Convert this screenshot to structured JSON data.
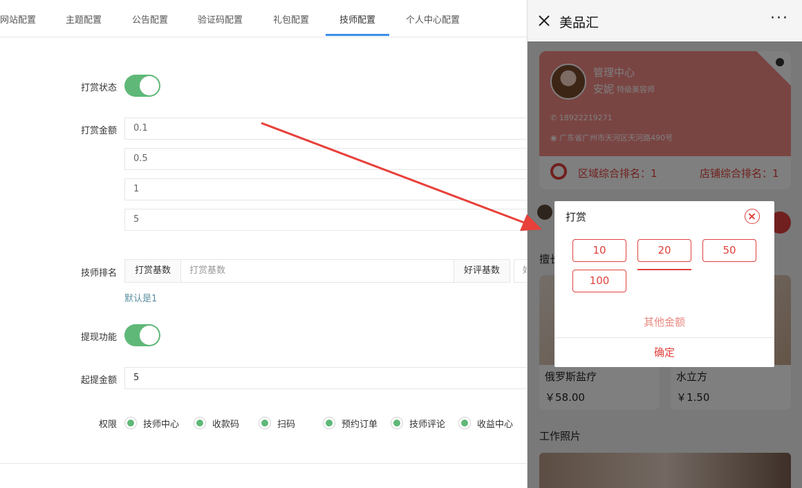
{
  "tabs": [
    {
      "label": "网站配置"
    },
    {
      "label": "主题配置"
    },
    {
      "label": "公告配置"
    },
    {
      "label": "验证码配置"
    },
    {
      "label": "礼包配置"
    },
    {
      "label": "技师配置",
      "active": true
    },
    {
      "label": "个人中心配置"
    }
  ],
  "form": {
    "tip_status_label": "打赏状态",
    "tip_status_on": true,
    "tip_amount_label": "打赏金额",
    "tip_amounts": [
      "0.1",
      "0.5",
      "1",
      "5"
    ],
    "ranking_label": "技师排名",
    "ranking_tip_base_label": "打赏基数",
    "ranking_tip_base_placeholder": "打赏基数",
    "ranking_review_base_label": "好评基数",
    "ranking_review_base_placeholder": "好",
    "default_hint": "默认是1",
    "withdraw_label": "提现功能",
    "withdraw_on": true,
    "min_withdraw_label": "起提金额",
    "min_withdraw_value": "5",
    "permission_label": "权限",
    "permissions": [
      "技师中心",
      "收款码",
      "扫码",
      "预约订单",
      "技师评论",
      "收益中心"
    ]
  },
  "phone": {
    "title": "美品汇",
    "more": "···",
    "card": {
      "heading": "管理中心",
      "name": "安妮",
      "level": "特级美容师",
      "phone": "18922219271",
      "address": "广东省广州市天河区天河路490号",
      "region_rank": "区域综合排名：1",
      "shop_rank": "店铺综合排名：1"
    },
    "section_partial": "擅长",
    "products": [
      {
        "name": "俄罗斯盐疗",
        "price": "￥58.00"
      },
      {
        "name": "水立方",
        "price": "￥1.50"
      }
    ],
    "photos_title": "工作照片"
  },
  "modal": {
    "title": "打赏",
    "amounts": [
      "10",
      "20",
      "50",
      "100"
    ],
    "selected": "20",
    "other": "其他金额",
    "confirm": "确定"
  },
  "colors": {
    "accent_green": "#5fb878",
    "accent_red": "#e0413c",
    "card_pink": "#f28b86",
    "tab_blue": "#3a8ee6"
  }
}
